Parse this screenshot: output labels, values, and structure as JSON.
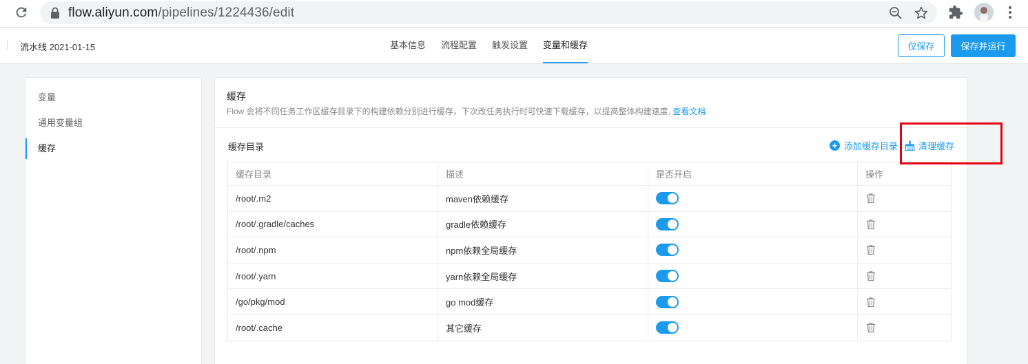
{
  "browser": {
    "url_host": "flow.aliyun.com",
    "url_path": "/pipelines/1224436/edit"
  },
  "header": {
    "pipeline_name": "流水线 2021-01-15",
    "tabs": [
      {
        "label": "基本信息",
        "active": false
      },
      {
        "label": "流程配置",
        "active": false
      },
      {
        "label": "触发设置",
        "active": false
      },
      {
        "label": "变量和缓存",
        "active": true
      }
    ],
    "save_label": "仅保存",
    "save_run_label": "保存并运行"
  },
  "sidebar": {
    "items": [
      {
        "label": "变量",
        "active": false
      },
      {
        "label": "通用变量组",
        "active": false
      },
      {
        "label": "缓存",
        "active": true
      }
    ]
  },
  "panel": {
    "title": "缓存",
    "description": "Flow 会将不同任务工作区缓存目录下的构建依赖分别进行缓存，下次改任务执行时可快速下载缓存，以提高整体构建速度,",
    "doc_link": "查看文档",
    "section_title": "缓存目录",
    "add_label": "添加缓存目录",
    "clear_label": "清理缓存"
  },
  "table": {
    "columns": [
      "缓存目录",
      "描述",
      "是否开启",
      "操作"
    ],
    "rows": [
      {
        "dir": "/root/.m2",
        "desc": "maven依赖缓存",
        "enabled": true
      },
      {
        "dir": "/root/.gradle/caches",
        "desc": "gradle依赖缓存",
        "enabled": true
      },
      {
        "dir": "/root/.npm",
        "desc": "npm依赖全局缓存",
        "enabled": true
      },
      {
        "dir": "/root/.yarn",
        "desc": "yarn依赖全局缓存",
        "enabled": true
      },
      {
        "dir": "/go/pkg/mod",
        "desc": "go mod缓存",
        "enabled": true
      },
      {
        "dir": "/root/.cache",
        "desc": "其它缓存",
        "enabled": true
      }
    ]
  },
  "colors": {
    "accent": "#1b9aee",
    "highlight": "#e60012"
  }
}
